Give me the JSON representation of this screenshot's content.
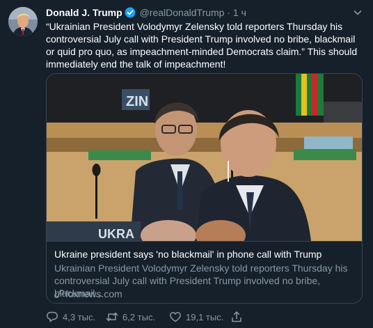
{
  "tweet": {
    "author_name": "Donald J. Trump",
    "handle": "@realDonaldTrump",
    "separator": "·",
    "time": "1 ч",
    "text": "“Ukrainian President Volodymyr Zelensky told reporters Thursday his controversial July call with President Trump involved no bribe, blackmail or quid pro quo, as impeachment-minded Democrats claim.” This should immediately end the talk of impeachment!"
  },
  "card": {
    "image_lettering": [
      "ZIN",
      "UKRA"
    ],
    "title": "Ukraine president says 'no blackmail' in phone call with Trump",
    "description": "Ukrainian President Volodymyr Zelensky told reporters Thursday his controversial July call with President Trump involved no bribe, blackmail...",
    "domain": "foxnews.com"
  },
  "actions": {
    "replies": "4,3 тыс.",
    "retweets": "6,2 тыс.",
    "likes": "19,1 тыс."
  },
  "colors": {
    "background": "#15202b",
    "secondary_text": "#8899a6",
    "border": "#38444d",
    "verified": "#1da1f2"
  }
}
